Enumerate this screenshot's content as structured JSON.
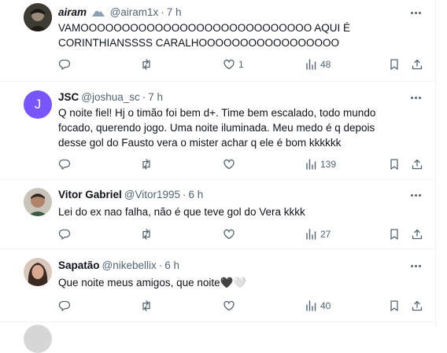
{
  "tweets": [
    {
      "name": "airam",
      "handle": "@airam1x",
      "time": "7 h",
      "text": "VAMOOOOOOOOOOOOOOOOOOOOOOOOOOOO AQUI É CORINTHIANSSSS CARALHOOOOOOOOOOOOOOOOO",
      "stats": {
        "replies": "",
        "reposts": "",
        "likes": "1",
        "views": "48"
      }
    },
    {
      "name": "JSC",
      "handle": "@joshua_sc",
      "time": "7 h",
      "avatar_letter": "J",
      "text": "Q noite fiel! Hj o timão foi bem d+. Time bem escalado, todo mundo focado, querendo jogo. Uma noite iluminada. Meu medo é q depois desse gol do Fausto vera o mister achar q ele é bom kkkkkk",
      "stats": {
        "replies": "",
        "reposts": "",
        "likes": "",
        "views": "139"
      }
    },
    {
      "name": "Vitor Gabriel",
      "handle": "@Vitor1995",
      "time": "6 h",
      "text": "Lei do ex nao falha, não é que teve gol do Vera kkkk",
      "stats": {
        "replies": "",
        "reposts": "",
        "likes": "",
        "views": "27"
      }
    },
    {
      "name": "Sapatão",
      "handle": "@nikebellix",
      "time": "6 h",
      "text": "Que noite meus amigos, que noite🖤🤍",
      "stats": {
        "replies": "",
        "reposts": "",
        "likes": "",
        "views": "40"
      }
    }
  ],
  "dot": "·",
  "colors": {
    "text": "#0f1419",
    "secondary": "#536471",
    "jsc_avatar": "#7856ff"
  },
  "icons": [
    "reply-icon",
    "repost-icon",
    "like-icon",
    "views-icon",
    "bookmark-icon",
    "share-icon",
    "more-icon"
  ]
}
